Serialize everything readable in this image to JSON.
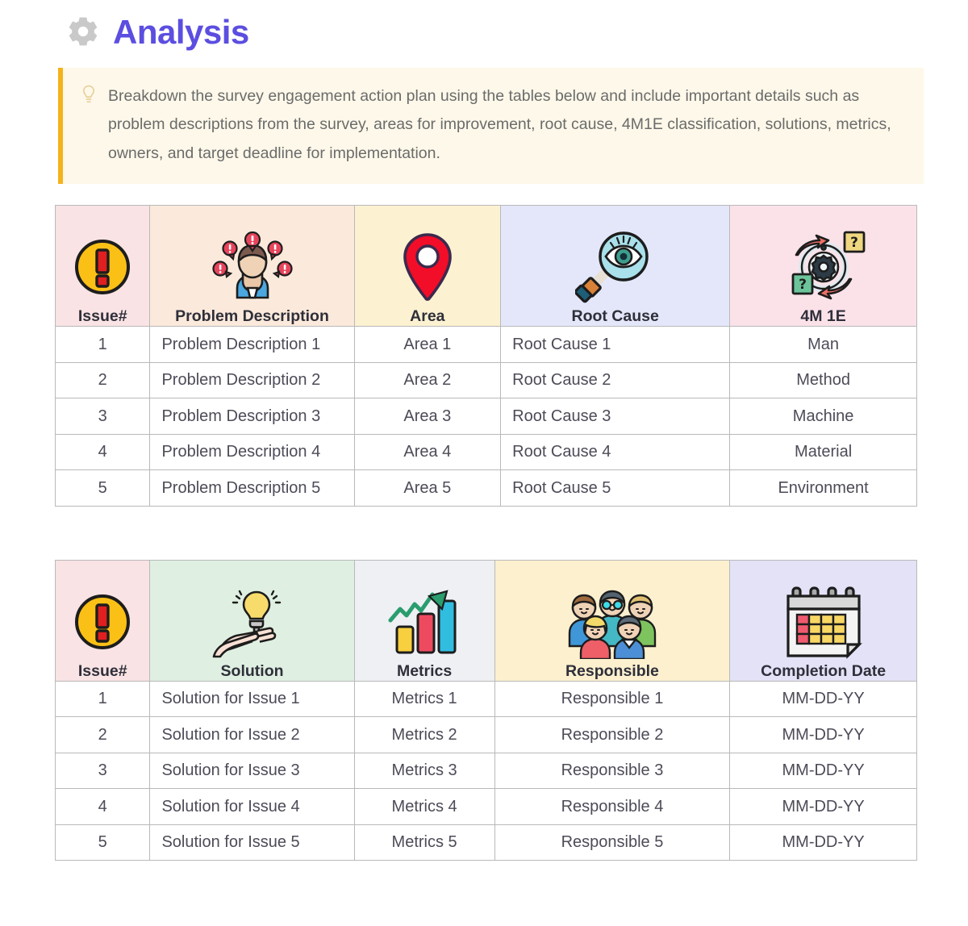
{
  "header": {
    "icon": "gear-icon",
    "title": "Analysis",
    "title_color": "#5b4ee0"
  },
  "callout": {
    "icon": "lightbulb-icon",
    "text": "Breakdown the survey engagement action plan using the tables below and include important details such as problem descriptions from the survey, areas for improvement, root cause, 4M1E classification, solutions, metrics, owners, and target deadline for implementation.",
    "background": "#fdf8e9",
    "accent": "#f5b31a"
  },
  "tables": [
    {
      "name": "problem-analysis-table",
      "columns": [
        {
          "label": "Issue#",
          "icon": "exclamation-circle-icon",
          "bg": "#f9e3e4",
          "width": "11.0%",
          "align": "center"
        },
        {
          "label": "Problem Description",
          "icon": "problem-person-icon",
          "bg": "#fbeadb",
          "width": "23.7%",
          "align": "left"
        },
        {
          "label": "Area",
          "icon": "map-pin-icon",
          "bg": "#fcf2d1",
          "width": "17.0%",
          "align": "center"
        },
        {
          "label": "Root Cause",
          "icon": "magnifier-eye-icon",
          "bg": "#e4e7fa",
          "width": "26.6%",
          "align": "left"
        },
        {
          "label": "4M 1E",
          "icon": "gear-arrows-icon",
          "bg": "#fbe2e9",
          "width": "21.7%",
          "align": "center"
        }
      ],
      "rows": [
        [
          "1",
          "Problem Description 1",
          "Area 1",
          "Root Cause 1",
          "Man"
        ],
        [
          "2",
          "Problem Description 2",
          "Area 2",
          "Root Cause 2",
          "Method"
        ],
        [
          "3",
          "Problem Description 3",
          "Area 3",
          "Root Cause 3",
          "Machine"
        ],
        [
          "4",
          "Problem Description 4",
          "Area 4",
          "Root Cause 4",
          "Material"
        ],
        [
          "5",
          "Problem Description 5",
          "Area 5",
          "Root Cause 5",
          "Environment"
        ]
      ]
    },
    {
      "name": "solution-plan-table",
      "columns": [
        {
          "label": "Issue#",
          "icon": "exclamation-circle-icon",
          "bg": "#f9e3e4",
          "width": "11.0%",
          "align": "center"
        },
        {
          "label": "Solution",
          "icon": "lightbulb-hand-icon",
          "bg": "#dff0e2",
          "width": "23.7%",
          "align": "left"
        },
        {
          "label": "Metrics",
          "icon": "bar-chart-growth-icon",
          "bg": "#eef0f4",
          "width": "16.3%",
          "align": "center"
        },
        {
          "label": "Responsible",
          "icon": "people-group-icon",
          "bg": "#fdf0cf",
          "width": "27.3%",
          "align": "center"
        },
        {
          "label": "Completion Date",
          "icon": "calendar-icon",
          "bg": "#e3e2f7",
          "width": "21.7%",
          "align": "center"
        }
      ],
      "rows": [
        [
          "1",
          "Solution for Issue 1",
          "Metrics 1",
          "Responsible 1",
          "MM-DD-YY"
        ],
        [
          "2",
          "Solution for Issue 2",
          "Metrics 2",
          "Responsible 2",
          "MM-DD-YY"
        ],
        [
          "3",
          "Solution for Issue 3",
          "Metrics 3",
          "Responsible 3",
          "MM-DD-YY"
        ],
        [
          "4",
          "Solution for Issue 4",
          "Metrics 4",
          "Responsible 4",
          "MM-DD-YY"
        ],
        [
          "5",
          "Solution for Issue 5",
          "Metrics 5",
          "Responsible 5",
          "MM-DD-YY"
        ]
      ]
    }
  ]
}
